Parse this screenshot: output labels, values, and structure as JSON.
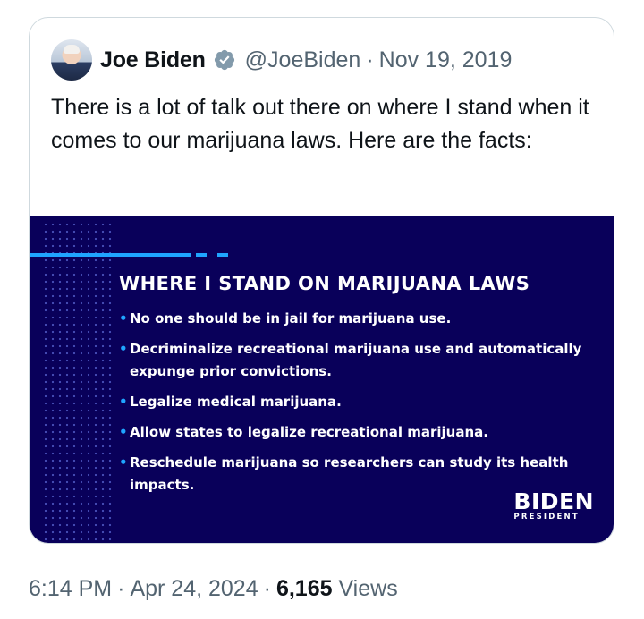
{
  "author": {
    "name": "Joe Biden",
    "handle": "@JoeBiden",
    "separator": "·",
    "date": "Nov 19, 2019"
  },
  "tweet_text": "There is a lot of talk out there on where I stand when it comes to our marijuana laws. Here are the facts:",
  "media": {
    "title": "WHERE I STAND ON MARIJUANA LAWS",
    "bullet": "•",
    "facts": [
      "No one should be in jail for marijuana use.",
      "Decriminalize recreational marijuana use and automatically expunge prior convictions.",
      "Legalize medical marijuana.",
      "Allow states to legalize recreational marijuana.",
      "Reschedule marijuana so researchers can study its health impacts."
    ],
    "logo_main": "BIDEN",
    "logo_sub": "PRESIDENT",
    "colors": {
      "background": "#09005a",
      "accent": "#1fa5ff"
    }
  },
  "meta": {
    "time": "6:14 PM",
    "separator": "·",
    "date": "Apr 24, 2024",
    "views_count": "6,165",
    "views_label": "Views"
  },
  "icons": {
    "verified": "verified-badge-icon",
    "avatar": "profile-photo"
  }
}
